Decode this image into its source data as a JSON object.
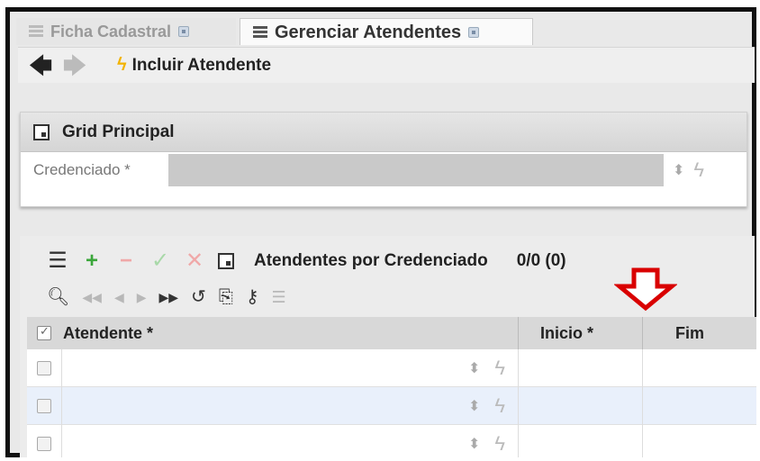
{
  "tabs": [
    {
      "label": "Ficha Cadastral",
      "active": false
    },
    {
      "label": "Gerenciar Atendentes",
      "active": true
    }
  ],
  "toolbar": {
    "back_icon": "arrow-left-icon",
    "forward_icon": "arrow-right-icon",
    "include_label": "Incluir Atendente"
  },
  "grid_principal": {
    "title": "Grid Principal",
    "field_label": "Credenciado *",
    "field_value": ""
  },
  "detail": {
    "title": "Atendentes por Credenciado",
    "count": "0/0 (0)"
  },
  "table": {
    "columns": [
      "Atendente *",
      "Inicio *",
      "Fim"
    ],
    "rows": [
      {
        "atendente": "",
        "inicio": "",
        "fim": ""
      },
      {
        "atendente": "",
        "inicio": "",
        "fim": ""
      },
      {
        "atendente": "",
        "inicio": "",
        "fim": ""
      }
    ]
  },
  "colors": {
    "accent_bolt": "#f2b300",
    "add_green": "#3aa63a",
    "annotation_red": "#d90000",
    "row_alt": "#e9f0fb"
  }
}
